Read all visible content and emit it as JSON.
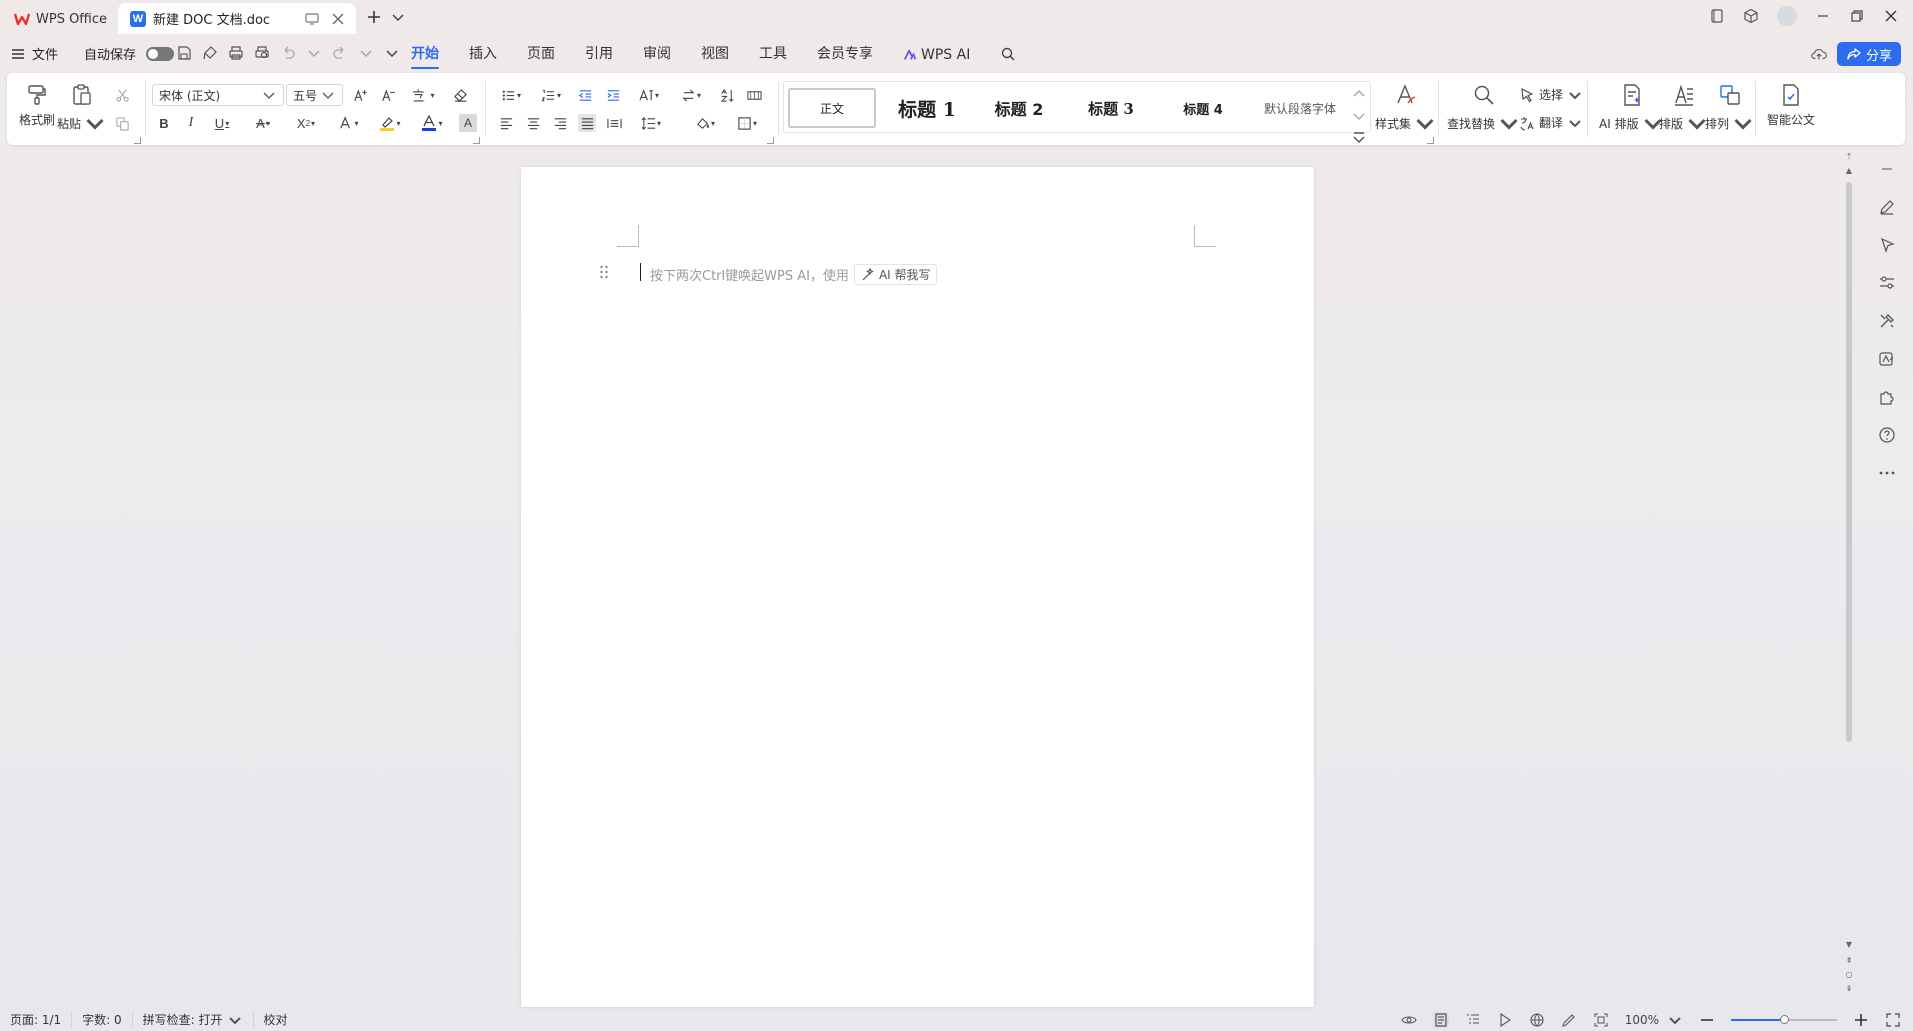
{
  "titlebar": {
    "home_tab": "WPS Office",
    "doc_tab": "新建 DOC 文档.doc"
  },
  "menubar": {
    "file": "文件",
    "autosave": "自动保存",
    "tabs": [
      "开始",
      "插入",
      "页面",
      "引用",
      "审阅",
      "视图",
      "工具",
      "会员专享"
    ],
    "wps_ai": "WPS AI",
    "share": "分享"
  },
  "ribbon": {
    "format_painter": "格式刷",
    "paste": "粘贴",
    "font_name": "宋体 (正文)",
    "font_size": "五号",
    "styles": {
      "normal": "正文",
      "h1": "标题 1",
      "h2": "标题 2",
      "h3": "标题 3",
      "h4": "标题 4",
      "default_para_font": "默认段落字体"
    },
    "style_set": "样式集",
    "find_replace": "查找替换",
    "select": "选择",
    "translate": "翻译",
    "ai_layout": "AI 排版",
    "layout": "排版",
    "arrange": "排列",
    "smart_doc": "智能公文"
  },
  "document": {
    "placeholder": "按下两次Ctrl键唤起WPS AI，使用",
    "ai_help": "AI 帮我写"
  },
  "statusbar": {
    "page": "页面: 1/1",
    "words": "字数: 0",
    "spell_check": "拼写检查: 打开",
    "proofread": "校对",
    "zoom": "100%",
    "zoom_level": 0.5
  },
  "colors": {
    "accent": "#2b6cf0",
    "wps_red": "#e5322d",
    "highlight": "#f5d31b",
    "font_color": "#1b3fd6"
  }
}
